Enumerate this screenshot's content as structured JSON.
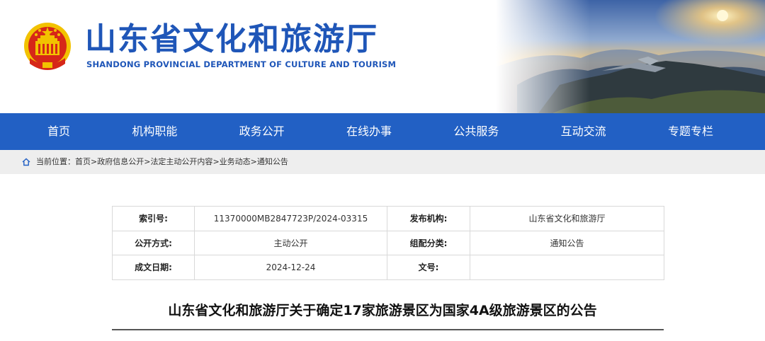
{
  "header": {
    "title": "山东省文化和旅游厅",
    "subtitle": "SHANDONG PROVINCIAL DEPARTMENT OF CULTURE AND  TOURISM"
  },
  "nav": {
    "items": [
      "首页",
      "机构职能",
      "政务公开",
      "在线办事",
      "公共服务",
      "互动交流",
      "专题专栏"
    ]
  },
  "breadcrumb": {
    "label": "当前位置：",
    "items": [
      "首页",
      "政府信息公开",
      "法定主动公开内容",
      "业务动态",
      "通知公告"
    ],
    "separator": ">"
  },
  "meta": {
    "index_label": "索引号:",
    "index_value": "11370000MB2847723P/2024-03315",
    "publisher_label": "发布机构:",
    "publisher_value": "山东省文化和旅游厅",
    "open_mode_label": "公开方式:",
    "open_mode_value": "主动公开",
    "category_label": "组配分类:",
    "category_value": "通知公告",
    "date_label": "成文日期:",
    "date_value": "2024-12-24",
    "doc_no_label": "文号:",
    "doc_no_value": ""
  },
  "article": {
    "title": "山东省文化和旅游厅关于确定17家旅游景区为国家4A级旅游景区的公告"
  },
  "colors": {
    "brand_blue": "#1f56b8",
    "nav_blue": "#2260c4",
    "emblem_red": "#d62718",
    "emblem_gold": "#f2c200"
  },
  "icons": {
    "emblem": "national-emblem",
    "home": "home-icon"
  }
}
